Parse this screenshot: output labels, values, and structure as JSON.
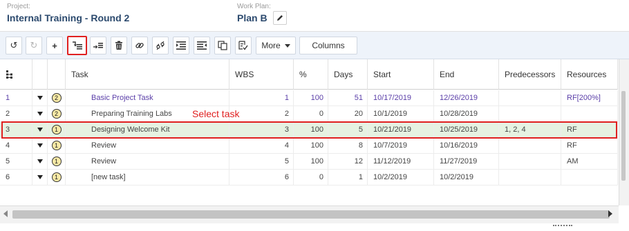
{
  "header": {
    "project_label": "Project:",
    "project_name": "Internal Training - Round 2",
    "workplan_label": "Work Plan:",
    "workplan_name": "Plan B"
  },
  "toolbar": {
    "undo": "↺",
    "redo": "↻",
    "add": "+",
    "indent_task": "⭢≡",
    "outdent_task": "⇢≡",
    "delete": "🗑",
    "link": "🔗",
    "unlink": "⛓",
    "indent": "⇥",
    "outdent": "⇤",
    "copy": "⧉",
    "checklist": "☑",
    "more_label": "More",
    "columns_label": "Columns"
  },
  "grid": {
    "columns": [
      "Task",
      "WBS",
      "%",
      "Days",
      "Start",
      "End",
      "Predecessors",
      "Resources"
    ],
    "hier_icon": "⁝"
  },
  "rows": [
    {
      "num": "1",
      "level": "2",
      "task": "Basic Project Task",
      "wbs": "1",
      "pct": "100",
      "days": "51",
      "start": "10/17/2019",
      "end": "12/26/2019",
      "pred": "",
      "res": "RF[200%]"
    },
    {
      "num": "2",
      "level": "2",
      "task": "Preparing Training Labs",
      "wbs": "2",
      "pct": "0",
      "days": "20",
      "start": "10/1/2019",
      "end": "10/28/2019",
      "pred": "",
      "res": ""
    },
    {
      "num": "3",
      "level": "1",
      "task": "Designing Welcome Kit",
      "wbs": "3",
      "pct": "100",
      "days": "5",
      "start": "10/21/2019",
      "end": "10/25/2019",
      "pred": "1, 2, 4",
      "res": "RF"
    },
    {
      "num": "4",
      "level": "1",
      "task": "Review",
      "wbs": "4",
      "pct": "100",
      "days": "8",
      "start": "10/7/2019",
      "end": "10/16/2019",
      "pred": "",
      "res": "RF"
    },
    {
      "num": "5",
      "level": "1",
      "task": "Review",
      "wbs": "5",
      "pct": "100",
      "days": "12",
      "start": "11/12/2019",
      "end": "11/27/2019",
      "pred": "",
      "res": "AM"
    },
    {
      "num": "6",
      "level": "1",
      "task": "[new task]",
      "wbs": "6",
      "pct": "0",
      "days": "1",
      "start": "10/2/2019",
      "end": "10/2/2019",
      "pred": "",
      "res": ""
    }
  ],
  "annotation": "Select task",
  "colors": {
    "accent": "#2c4a6e",
    "highlight": "#e02020",
    "selected_row": "#e6f2e2",
    "purple_text": "#5a3ea8"
  }
}
